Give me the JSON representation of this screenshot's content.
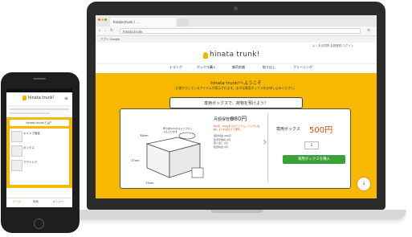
{
  "laptop": {
    "browser": {
      "tab_title": "hinata trunk / ...",
      "url": "hinata.trunk",
      "bookmarks": "アプリ  Google"
    },
    "site": {
      "logo": "hinata trunk!",
      "top_links": "よくある質問   会員登録   ログイン",
      "nav": [
        "トランク",
        "ボックス購入",
        "集荷依頼",
        "取り出し",
        "クリーニング"
      ],
      "hero_title": "hinata trunk!へようこそ",
      "hero_subtitle": "お預かりしているアイテムが表示されます。まずは専用ボックスをお申し込みください。",
      "ribbon": "専用ボックスで、荷物を預けよう！",
      "box_dimensions": {
        "height": "38cm",
        "depth": "37cm",
        "width": "75cm"
      },
      "box_note": "厚さ約5cmのキャンプマットも入ります",
      "plan_label": "月額保管料",
      "plan_price": "980円",
      "plan_desc": "約1年、20kgまでのアイテム。バッグに収納していれば立てて保管。",
      "specs": [
        "保管料金 980円",
        "集荷手数料 0円",
        "取り出し 0円",
        "配送料金 0円"
      ],
      "box_label": "専用ボックス",
      "box_price": "500円",
      "quantity": "1",
      "cta": "専用ボックスを購入"
    }
  },
  "phone": {
    "logo": "hinata trunk!",
    "banner": "hinata trunk!とは？",
    "item_rows": [
      "キャンプ用品",
      "ボックス",
      "アウトドア"
    ],
    "tabs": [
      "ホーム",
      "検索",
      "メニュー"
    ]
  },
  "colors": {
    "brand_yellow": "#f6b800",
    "cta_green": "#3aa138",
    "price_orange": "#e04b00"
  }
}
